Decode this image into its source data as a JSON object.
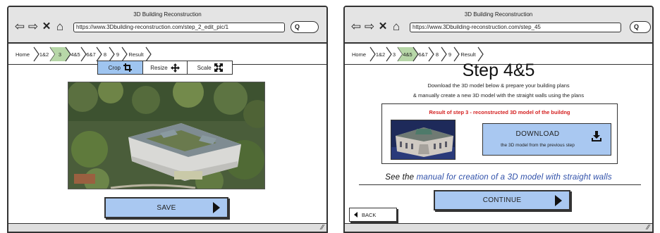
{
  "left_window": {
    "title": "3D Building Reconstruction",
    "url": "https://www.3Dbuilding-reconstruction.com/step_2_edit_pic/1",
    "nav_icons": [
      "back-arrow-icon",
      "forward-arrow-icon",
      "close-icon",
      "home-icon"
    ],
    "breadcrumbs": [
      {
        "label": "Home",
        "active": false
      },
      {
        "label": "1&2",
        "active": false
      },
      {
        "label": "3",
        "active": true
      },
      {
        "label": "4&5",
        "active": false
      },
      {
        "label": "6&7",
        "active": false
      },
      {
        "label": "8",
        "active": false
      },
      {
        "label": "9",
        "active": false
      },
      {
        "label": "Result",
        "active": false
      }
    ],
    "tools": [
      {
        "label": "Crop",
        "icon": "crop-icon",
        "active": true
      },
      {
        "label": "Resize",
        "icon": "move-icon",
        "active": false
      },
      {
        "label": "Scale",
        "icon": "scale-icon",
        "active": false
      }
    ],
    "save_label": "SAVE"
  },
  "right_window": {
    "title": "3D Building Reconstruction",
    "url": "https://www.3Dbuilding-reconstruction.com/step_45",
    "nav_icons": [
      "back-arrow-icon",
      "forward-arrow-icon",
      "close-icon",
      "home-icon"
    ],
    "breadcrumbs": [
      {
        "label": "Home",
        "active": false
      },
      {
        "label": "1&2",
        "active": false
      },
      {
        "label": "3",
        "active": false
      },
      {
        "label": "4&5",
        "active": true
      },
      {
        "label": "6&7",
        "active": false
      },
      {
        "label": "8",
        "active": false
      },
      {
        "label": "9",
        "active": false
      },
      {
        "label": "Result",
        "active": false
      }
    ],
    "heading": "Step 4&5",
    "desc_line1": "Download the 3D model below & prepare your building plans",
    "desc_line2": "& manually create a new 3D model with the straight walls using the plans",
    "result_title": "Result of step 3 - reconstructed 3D model of the buildng",
    "download_label": "DOWNLOAD",
    "download_sub": "the 3D model from the previous step",
    "manual_prefix": "See the ",
    "manual_link": "manual for creation of a 3D model with straight walls",
    "continue_label": "CONTINUE",
    "back_label": "BACK"
  },
  "colors": {
    "button_blue": "#a9c8f1",
    "active_crumb": "#b7d7a8",
    "result_red": "#d42020",
    "link_blue": "#2d4ea8"
  }
}
